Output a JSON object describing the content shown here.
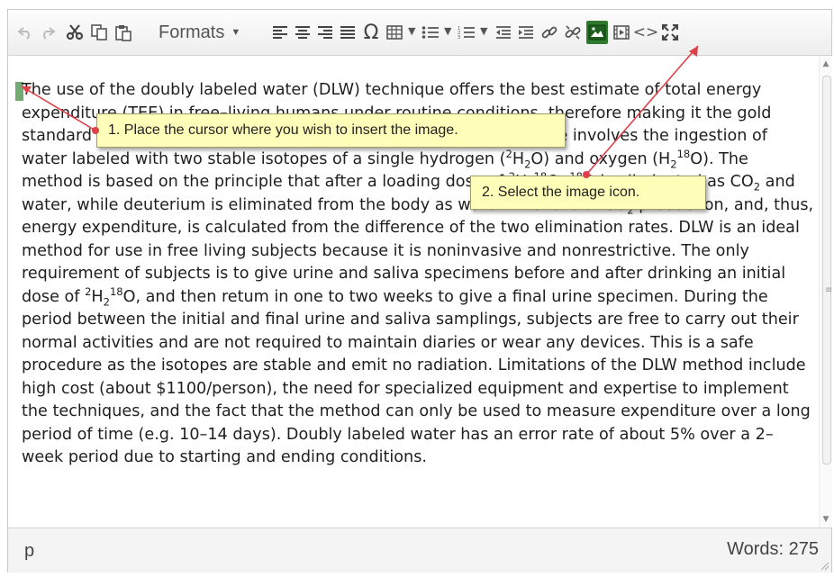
{
  "toolbar": {
    "formats_label": "Formats",
    "buttons": [
      "undo-icon",
      "redo-icon",
      "cut-icon",
      "copy-icon",
      "paste-icon",
      "align-left-icon",
      "align-center-icon",
      "align-right-icon",
      "justify-icon",
      "special-character-icon",
      "table-icon",
      "bullet-list-icon",
      "numbered-list-icon",
      "outdent-icon",
      "indent-icon",
      "link-icon",
      "unlink-icon",
      "image-icon",
      "media-icon",
      "source-code-icon",
      "fullscreen-icon"
    ],
    "accent_image_button": "#2f7a2f"
  },
  "content": {
    "p1": "The use of the doubly labeled water (DLW) technique offers the best estimate of total energy expenditure (TEE) in free–living humans under routine conditions, therefore making it the gold standard for validation of other TEE validation studies.The technique involves the ingestion of water labeled with two stable isotopes of a single hydrogen (",
    "p2": "H",
    "p3": "O) and oxygen (H",
    "p4": "O).  The method is based on the principle that after a loading dose of ",
    "p5": "H",
    "p6": "O, ",
    "p7": "O is eliminated as CO",
    "p8": " and water, while deuterium is eliminated from the body as water.  The rate of CO",
    "p9": " production, and, thus, energy expenditure, is calculated from the difference of the two elimination rates. DLW is an ideal method for use in free living subjects because it is noninvasive and nonrestrictive. The only requirement of subjects is to give urine and saliva specimens before and after drinking an initial dose of ",
    "p10": "H",
    "p11": "O, and then retum in one to two weeks to give a final urine specimen.  During the period between the initial and final urine and saliva samplings, subjects are free to carry out their normal activities and are not required to maintain diaries or wear any devices.  This is a safe procedure as the isotopes are stable and emit no radiation.  Limitations of the DLW method include high cost (about $1100/person), the need for specialized equipment and expertise to implement the techniques, and the fact that the method can only be used to measure expenditure over a long period of time (e.g. 10–14 days).  Doubly labeled water has an error rate of about 5% over a 2–week period due to starting and ending conditions.",
    "sup_2": "2",
    "sup_18": "18",
    "sub_2": "2"
  },
  "statusbar": {
    "path": "p",
    "word_count": "Words: 275"
  },
  "callouts": {
    "step1": "1. Place the cursor where you wish to insert the image.",
    "step2": "2. Select the image icon."
  },
  "colors": {
    "callout_bg": "#ffffb9",
    "arrow": "#e0404a"
  }
}
